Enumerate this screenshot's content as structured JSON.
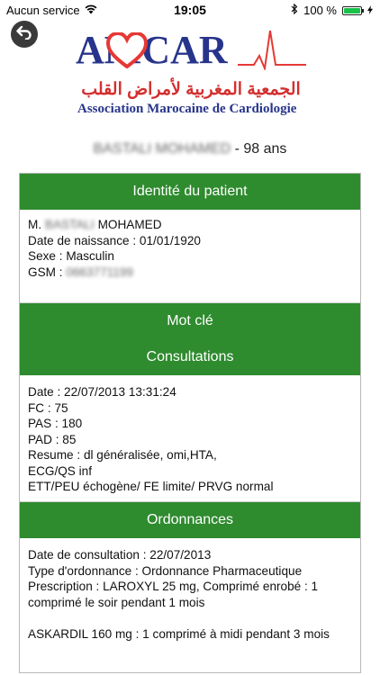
{
  "status_bar": {
    "carrier": "Aucun service",
    "time": "19:05",
    "battery_text": "100 %",
    "battery_level": 1.0
  },
  "logo": {
    "wordmark": "AMCAR",
    "arabic": "الجمعية المغربية لأمراض القلب",
    "french": "Association Marocaine de Cardiologie"
  },
  "patient_header": {
    "name": "BASTALI MOHAMED",
    "age_suffix": " - 98 ans"
  },
  "identity": {
    "title": "Identité du patient",
    "name_prefix": "M. ",
    "name_blurred": "BASTALI",
    "name_rest": " MOHAMED",
    "birth": "Date de naissance : 01/01/1920",
    "sex": "Sexe : Masculin",
    "gsm_label": "GSM : ",
    "gsm_value": "0663771199"
  },
  "keyword": {
    "title": "Mot clé"
  },
  "consultations": {
    "title": "Consultations",
    "lines": [
      "Date : 22/07/2013 13:31:24",
      "FC : 75",
      "PAS : 180",
      "PAD : 85",
      "Resume : dl généralisée, omi,HTA,",
      "ECG/QS inf",
      "ETT/PEU échogène/ FE limite/ PRVG normal"
    ]
  },
  "ordonnances": {
    "title": "Ordonnances",
    "lines": [
      "Date de consultation : 22/07/2013",
      "Type d'ordonnance : Ordonnance Pharmaceutique",
      "Prescription : LAROXYL 25 mg, Comprimé enrobé :  1 comprimé le soir    pendant 1 mois"
    ],
    "second_prescription": "ASKARDIL 160 mg :  1 comprimé à midi    pendant 3 mois"
  }
}
